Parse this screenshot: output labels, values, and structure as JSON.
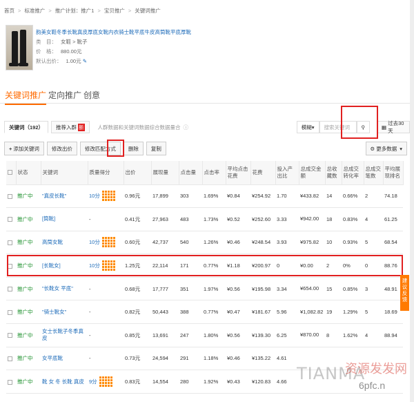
{
  "breadcrumb": [
    "首页",
    "标准推广",
    "推广计划：推广1",
    "宝贝推广",
    "关键词推广"
  ],
  "product": {
    "title": "韵美女鞋冬季长靴真皮厚底女靴内衣骑士靴平底牛皮高筒靴平底厚靴",
    "category_label": "类　目：",
    "category": "女鞋 > 靴子",
    "price_label": "价　格：",
    "price": "880.00元",
    "bid_label": "默认出价：",
    "bid": "1.00元"
  },
  "tabs": [
    "关键词推广",
    "定向推广",
    "创意"
  ],
  "filter_bar": {
    "keywords_tab": "关键词（192）",
    "suggest_tab": "推荐入群",
    "hint": "人群数据和关键词数据综合数据量合",
    "search_placeholder": "搜索关键词",
    "search_field": "模糊",
    "period": "过去30天"
  },
  "actions": [
    "添加关键词",
    "修改出价",
    "修改匹配方式",
    "删除",
    "复制"
  ],
  "more_data": "更多数据",
  "columns": [
    "状态",
    "关键词",
    "质量得分",
    "出价",
    "展现量",
    "点击量",
    "点击率",
    "平均点击花费",
    "花费",
    "投入产出比",
    "总成交金额",
    "总收藏数",
    "总成交转化率",
    "总成交笔数",
    "平均展现排名"
  ],
  "rows": [
    {
      "status": "推广中",
      "keyword": "\"真皮长靴\"",
      "score": "10分",
      "bid": "0.96元",
      "impr": "17,899",
      "clicks": "303",
      "ctr": "1.69%",
      "cpc": "¥0.84",
      "cost": "¥254.92",
      "roi": "1.70",
      "amount": "¥433.82",
      "fav": "14",
      "cvr": "0.66%",
      "orders": "2",
      "rank": "74.18"
    },
    {
      "status": "推广中",
      "keyword": "[筒靴]",
      "score": "-",
      "bid": "0.41元",
      "impr": "27,963",
      "clicks": "483",
      "ctr": "1.73%",
      "cpc": "¥0.52",
      "cost": "¥252.60",
      "roi": "3.33",
      "amount": "¥942.00",
      "fav": "18",
      "cvr": "0.83%",
      "orders": "4",
      "rank": "61.25"
    },
    {
      "status": "推广中",
      "keyword": "高筒女靴",
      "score": "10分",
      "bid": "0.60元",
      "impr": "42,737",
      "clicks": "540",
      "ctr": "1.26%",
      "cpc": "¥0.46",
      "cost": "¥248.54",
      "roi": "3.93",
      "amount": "¥975.82",
      "fav": "10",
      "cvr": "0.93%",
      "orders": "5",
      "rank": "68.54"
    },
    {
      "status": "推广中",
      "keyword": "[长靴女]",
      "score": "10分",
      "bid": "1.25元",
      "impr": "22,114",
      "clicks": "171",
      "ctr": "0.77%",
      "cpc": "¥1.18",
      "cost": "¥200.97",
      "roi": "0",
      "amount": "¥0.00",
      "fav": "2",
      "cvr": "0%",
      "orders": "0",
      "rank": "88.76"
    },
    {
      "status": "推广中",
      "keyword": "\"长靴女 平底\"",
      "score": "-",
      "bid": "0.68元",
      "impr": "17,777",
      "clicks": "351",
      "ctr": "1.97%",
      "cpc": "¥0.56",
      "cost": "¥195.98",
      "roi": "3.34",
      "amount": "¥654.00",
      "fav": "15",
      "cvr": "0.85%",
      "orders": "3",
      "rank": "48.91"
    },
    {
      "status": "推广中",
      "keyword": "\"骑士靴女\"",
      "score": "-",
      "bid": "0.82元",
      "impr": "50,443",
      "clicks": "388",
      "ctr": "0.77%",
      "cpc": "¥0.47",
      "cost": "¥181.67",
      "roi": "5.96",
      "amount": "¥1,082.82",
      "fav": "19",
      "cvr": "1.29%",
      "orders": "5",
      "rank": "18.69"
    },
    {
      "status": "推广中",
      "keyword": "女士长靴子冬季真皮",
      "score": "-",
      "bid": "0.85元",
      "impr": "13,691",
      "clicks": "247",
      "ctr": "1.80%",
      "cpc": "¥0.56",
      "cost": "¥139.30",
      "roi": "6.25",
      "amount": "¥870.00",
      "fav": "8",
      "cvr": "1.62%",
      "orders": "4",
      "rank": "88.94"
    },
    {
      "status": "推广中",
      "keyword": "女平底靴",
      "score": "-",
      "bid": "0.73元",
      "impr": "24,594",
      "clicks": "291",
      "ctr": "1.18%",
      "cpc": "¥0.46",
      "cost": "¥135.22",
      "roi": "4.61",
      "amount": "",
      "fav": "",
      "cvr": "",
      "orders": "",
      "rank": ""
    },
    {
      "status": "推广中",
      "keyword": "靴 女 冬 长靴 真皮",
      "score": "9分",
      "bid": "0.83元",
      "impr": "14,554",
      "clicks": "280",
      "ctr": "1.92%",
      "cpc": "¥0.43",
      "cost": "¥120.83",
      "roi": "4.66",
      "amount": "",
      "fav": "",
      "cvr": "",
      "orders": "",
      "rank": ""
    }
  ],
  "side_button": "建议反馈",
  "watermark": {
    "latin": "TIANMA",
    "cn": "资源发发网",
    "url": "6pfc.n"
  }
}
